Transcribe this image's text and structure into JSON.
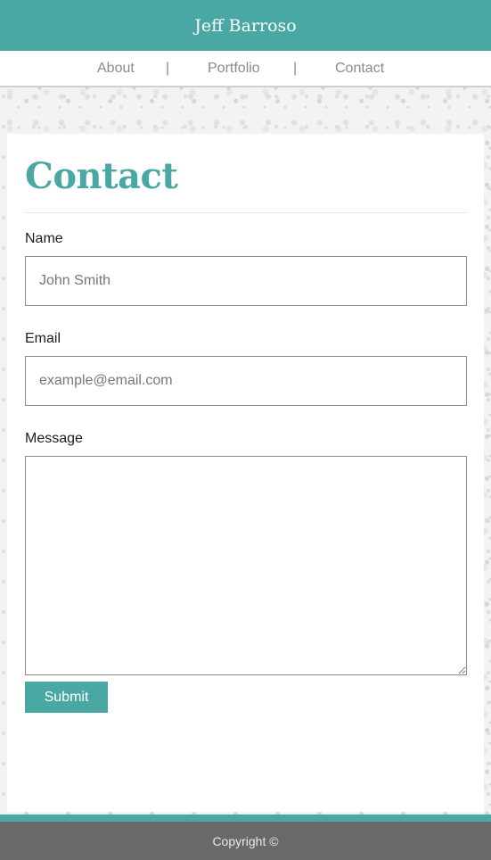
{
  "site": {
    "title": "Jeff Barroso"
  },
  "nav": {
    "items": [
      {
        "label": "About"
      },
      {
        "label": "Portfolio"
      },
      {
        "label": "Contact"
      }
    ],
    "separator": "|"
  },
  "contact": {
    "title": "Contact",
    "name": {
      "label": "Name",
      "placeholder": "John Smith",
      "value": ""
    },
    "email": {
      "label": "Email",
      "placeholder": "example@email.com",
      "value": ""
    },
    "message": {
      "label": "Message",
      "value": ""
    },
    "submit_label": "Submit"
  },
  "footer": {
    "text": "Copyright ©"
  },
  "colors": {
    "accent": "#4aa8a4",
    "footer_bg": "#696969",
    "nav_text": "#8a8a8a"
  }
}
